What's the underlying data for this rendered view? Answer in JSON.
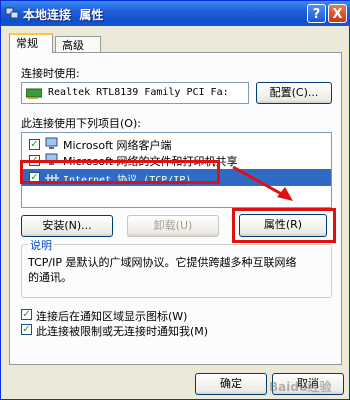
{
  "window": {
    "title": "本地连接  属性",
    "help_button": "?",
    "close_button": "X"
  },
  "tabs": [
    {
      "label": "常规",
      "active": true
    },
    {
      "label": "高级",
      "active": false
    }
  ],
  "connect_using": {
    "label": "连接时使用:",
    "adapter": "Realtek RTL8139 Family PCI Fa:",
    "configure_button": "配置(C)..."
  },
  "items_section": {
    "label": "此连接使用下列项目(O):",
    "items": [
      {
        "label": "Microsoft 网络客户端",
        "checked": true
      },
      {
        "label": "Microsoft 网络的文件和打印机共享",
        "checked": true
      },
      {
        "label": "Internet 协议 (TCP/IP)",
        "checked": true,
        "selected": true
      }
    ]
  },
  "buttons": {
    "install": "安装(N)...",
    "uninstall": "卸载(U)",
    "properties": "属性(R)"
  },
  "description": {
    "title": "说明",
    "text_line1": "TCP/IP 是默认的广域网协议。它提供跨越多种互联网络",
    "text_line2": "的通讯。"
  },
  "options": [
    {
      "label": "连接后在通知区域显示图标(W)",
      "checked": true
    },
    {
      "label": "此连接被限制或无连接时通知我(M)",
      "checked": true
    }
  ],
  "dialog_buttons": {
    "ok": "确定",
    "cancel": "取消"
  },
  "watermark": "Baidu经验",
  "colors": {
    "titlebar": "#1f5fd8",
    "highlight": "#316ac5",
    "annotation_red": "#e01010",
    "link_blue": "#0046d5"
  }
}
